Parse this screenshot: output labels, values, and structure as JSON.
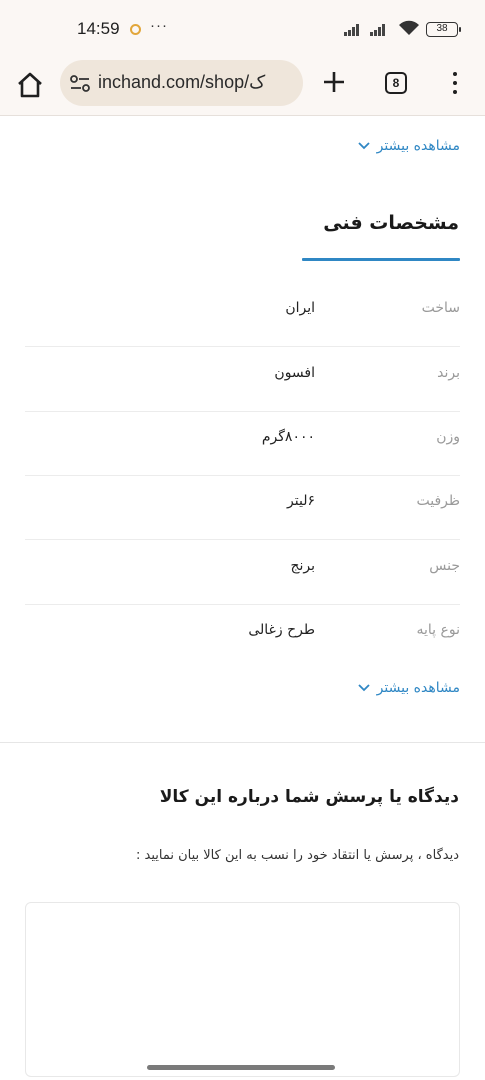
{
  "status_bar": {
    "time": "14:59",
    "more_indicator": "···",
    "battery": "38"
  },
  "toolbar": {
    "url": "inchand.com/shop/ک",
    "tab_count": "8",
    "icons": {
      "home": "home-icon",
      "site_info": "tune-icon",
      "new_tab": "plus-icon",
      "tabs": "tabs-icon",
      "menu": "more-vert-icon"
    }
  },
  "top_see_more": {
    "label": "مشاهده بیشتر"
  },
  "specs": {
    "title": "مشخصات فنی",
    "rows": [
      {
        "label": "ساخت",
        "value": "ایران"
      },
      {
        "label": "برند",
        "value": "افسون"
      },
      {
        "label": "وزن",
        "value": "۸۰۰۰گرم"
      },
      {
        "label": "ظرفیت",
        "value": "۶لیتر"
      },
      {
        "label": "جنس",
        "value": "برنج"
      },
      {
        "label": "نوع پایه",
        "value": "طرح زغالی"
      }
    ],
    "see_more": "مشاهده بیشتر"
  },
  "comments": {
    "title": "دیدگاه یا پرسش شما درباره این کالا",
    "hint": "دیدگاه ، پرسش یا انتقاد خود را نسب به این کالا بیان نمایید :",
    "textarea_value": ""
  },
  "colors": {
    "accent": "#2f87c4",
    "toolbar_bg": "#fbf7f4",
    "url_bar_bg": "#efe6db",
    "label_gray": "#9a9a9a"
  }
}
